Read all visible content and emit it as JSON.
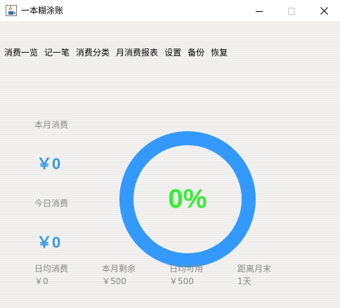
{
  "window": {
    "title": "一本糊涂账"
  },
  "menu": {
    "items": [
      "消费一览",
      "记一笔",
      "消费分类",
      "月消费报表",
      "设置",
      "备份",
      "恢复"
    ]
  },
  "summary": {
    "month_label": "本月消费",
    "month_amount": "￥0",
    "today_label": "今日消费",
    "today_amount": "￥0",
    "progress_text": "0%",
    "progress_value": 0
  },
  "stats": [
    {
      "label": "日均消费",
      "value": "￥0"
    },
    {
      "label": "本月剩余",
      "value": "￥500"
    },
    {
      "label": "日均可用",
      "value": "￥500"
    },
    {
      "label": "距离月末",
      "value": "1天"
    }
  ],
  "colors": {
    "amount": "#3598e6",
    "ring": "#3399ff",
    "percent": "#33ee33"
  },
  "icons": {
    "app": "java-cup-icon",
    "minimize": "minimize-icon",
    "maximize": "maximize-icon",
    "close": "close-icon"
  }
}
